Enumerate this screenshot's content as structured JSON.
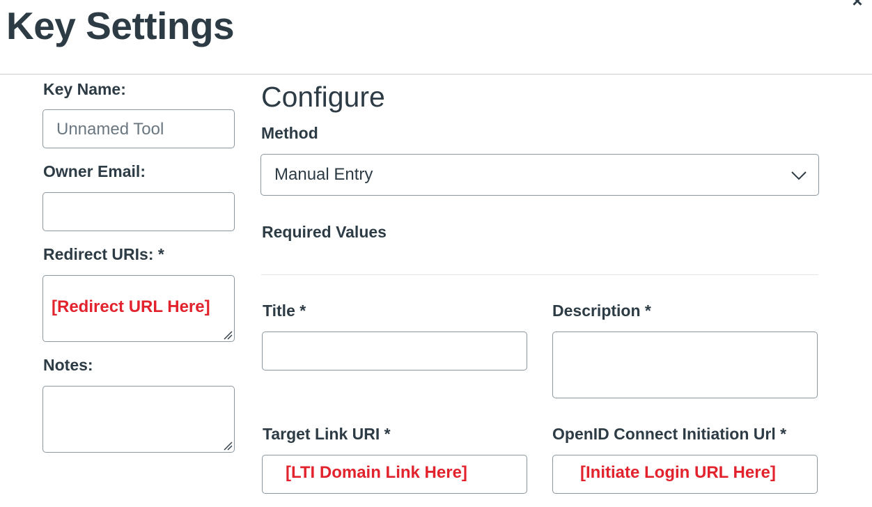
{
  "header": {
    "title": "Key Settings",
    "close_label": "×"
  },
  "left": {
    "key_name_label": "Key Name:",
    "key_name_placeholder": "Unnamed Tool",
    "owner_email_label": "Owner Email:",
    "owner_email_value": "",
    "redirect_uris_label": "Redirect URIs: *",
    "redirect_uris_value": "[Redirect URL Here]",
    "notes_label": "Notes:",
    "notes_value": ""
  },
  "configure": {
    "title": "Configure",
    "method_label": "Method",
    "method_value": "Manual Entry",
    "required_values_label": "Required Values",
    "title_label": "Title *",
    "title_value": "",
    "description_label": "Description *",
    "description_value": "",
    "target_link_label": "Target Link URI *",
    "target_link_value": "[LTI Domain Link Here]",
    "oidc_label": "OpenID Connect Initiation Url *",
    "oidc_value": "[Initiate Login URL Here]"
  },
  "colors": {
    "text": "#2d3b45",
    "border": "#8b969e",
    "annotation_red": "#e2232d"
  },
  "icons": {
    "close": "close-icon",
    "dropdown": "chevron-down-icon",
    "resize": "resize-grip-icon"
  }
}
